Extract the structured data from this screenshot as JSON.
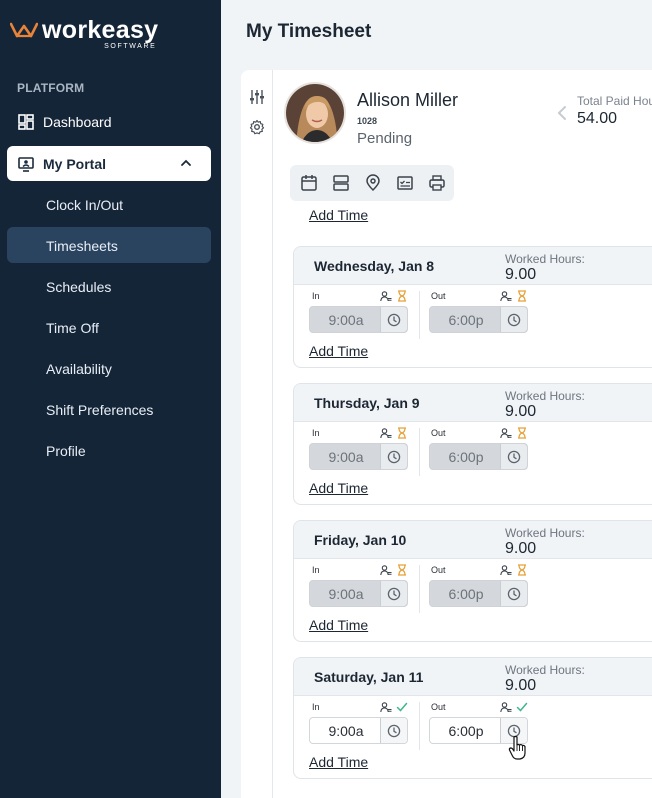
{
  "brand": {
    "name": "workeasy",
    "sub": "SOFTWARE"
  },
  "sidebar": {
    "section": "PLATFORM",
    "dashboard": "Dashboard",
    "portal": "My Portal",
    "sub_items": [
      "Clock In/Out",
      "Timesheets",
      "Schedules",
      "Time Off",
      "Availability",
      "Shift Preferences",
      "Profile"
    ],
    "active_sub": "Timesheets"
  },
  "page": {
    "title": "My Timesheet"
  },
  "employee": {
    "name": "Allison Miller",
    "id": "1028",
    "status": "Pending"
  },
  "summary": {
    "label": "Total Paid Hou",
    "value": "54.00"
  },
  "top_add_time": "Add Time",
  "days": [
    {
      "day": "Wednesday, Jan 8",
      "worked_label": "Worked Hours:",
      "worked": "9.00",
      "in_label": "In",
      "out_label": "Out",
      "in": "9:00a",
      "out": "6:00p",
      "state": "pending",
      "add": "Add Time"
    },
    {
      "day": "Thursday, Jan 9",
      "worked_label": "Worked Hours:",
      "worked": "9.00",
      "in_label": "In",
      "out_label": "Out",
      "in": "9:00a",
      "out": "6:00p",
      "state": "pending",
      "add": "Add Time"
    },
    {
      "day": "Friday, Jan 10",
      "worked_label": "Worked Hours:",
      "worked": "9.00",
      "in_label": "In",
      "out_label": "Out",
      "in": "9:00a",
      "out": "6:00p",
      "state": "pending",
      "add": "Add Time"
    },
    {
      "day": "Saturday, Jan 11",
      "worked_label": "Worked Hours:",
      "worked": "9.00",
      "in_label": "In",
      "out_label": "Out",
      "in": "9:00a",
      "out": "6:00p",
      "state": "approved",
      "add": "Add Time"
    }
  ],
  "colors": {
    "sidebar": "#152538",
    "accent": "#e8833a",
    "pending": "#e8a23a",
    "approved": "#3fb68b"
  },
  "icons": [
    "sliders-icon",
    "gear-icon",
    "calendar-icon",
    "rows-icon",
    "location-pin-icon",
    "checklist-icon",
    "printer-icon",
    "clock-icon",
    "user-check-icon",
    "hourglass-icon",
    "checkmark-icon",
    "chevron-up-icon",
    "chevron-left-icon",
    "dashboard-icon",
    "portal-icon"
  ]
}
